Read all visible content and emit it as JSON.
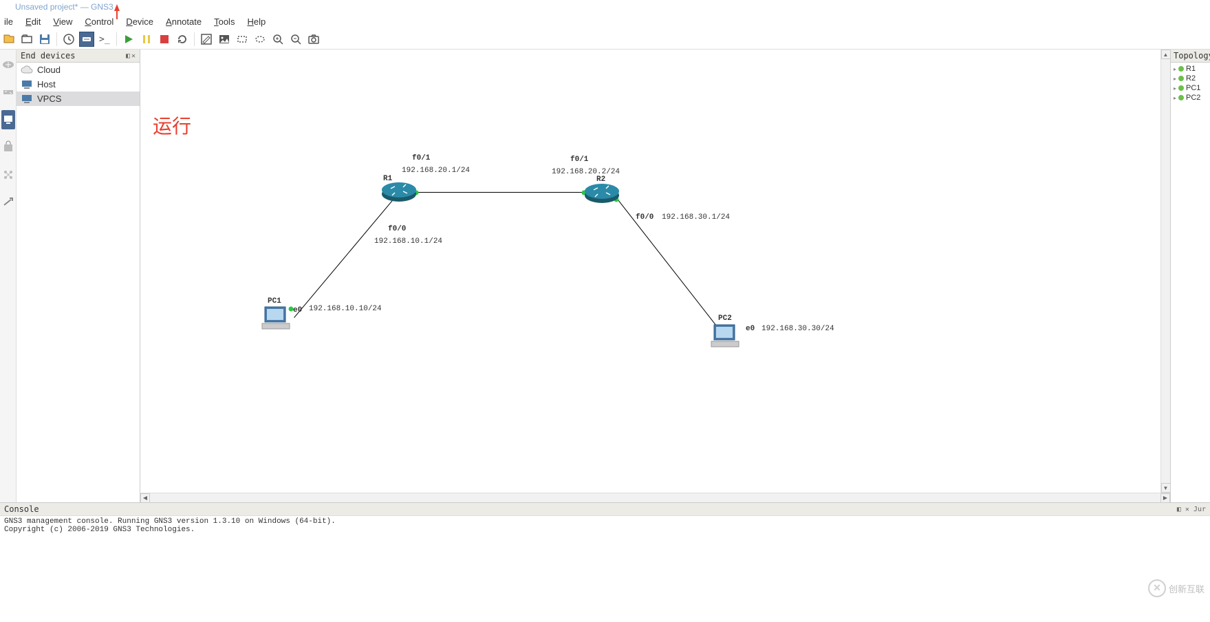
{
  "window": {
    "title": "Unsaved project* — GNS3"
  },
  "menu": [
    "ile",
    "Edit",
    "View",
    "Control",
    "Device",
    "Annotate",
    "Tools",
    "Help"
  ],
  "menu_ul": [
    "",
    "E",
    "V",
    "C",
    "D",
    "A",
    "T",
    "H"
  ],
  "panels": {
    "end_devices": {
      "title": "End devices",
      "items": [
        {
          "label": "Cloud",
          "type": "cloud"
        },
        {
          "label": "Host",
          "type": "computer"
        },
        {
          "label": "VPCS",
          "type": "computer",
          "selected": true
        }
      ]
    },
    "topology": {
      "title": "Topology",
      "items": [
        {
          "label": "R1"
        },
        {
          "label": "R2"
        },
        {
          "label": "PC1"
        },
        {
          "label": "PC2"
        }
      ]
    }
  },
  "canvas": {
    "annotation": "运行",
    "nodes": {
      "r1": {
        "name": "R1"
      },
      "r2": {
        "name": "R2"
      },
      "pc1": {
        "name": "PC1"
      },
      "pc2": {
        "name": "PC2"
      }
    },
    "labels": {
      "r1_f01": "f0/1",
      "r1_f01_ip": "192.168.20.1/24",
      "r1_f00": "f0/0",
      "r1_f00_ip": "192.168.10.1/24",
      "r2_f01": "f0/1",
      "r2_f01_ip": "192.168.20.2/24",
      "r2_f00": "f0/0",
      "r2_f00_ip": "192.168.30.1/24",
      "pc1_e0": "e0",
      "pc1_ip": "192.168.10.10/24",
      "pc2_e0": "e0",
      "pc2_ip": "192.168.30.30/24"
    }
  },
  "console": {
    "title": "Console",
    "line1": "GNS3 management console. Running GNS3 version 1.3.10 on Windows (64-bit).",
    "line2": "Copyright (c) 2006-2019 GNS3 Technologies.",
    "right_tag": "Jur"
  },
  "watermark": "创新互联"
}
